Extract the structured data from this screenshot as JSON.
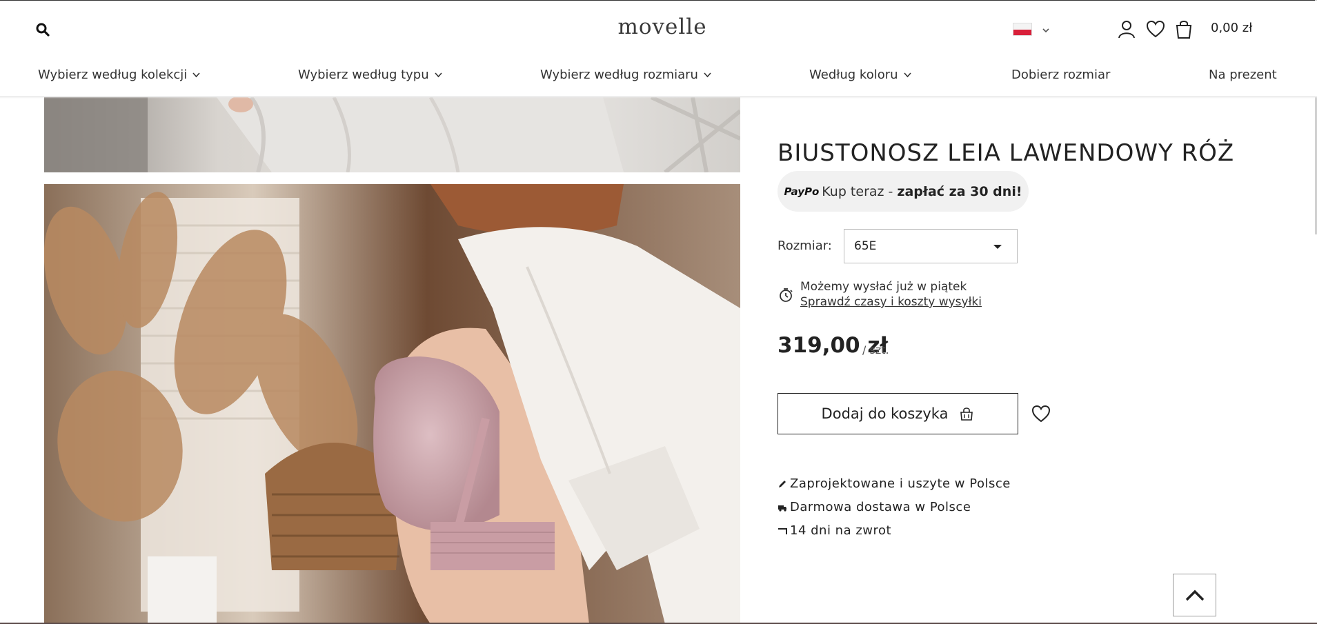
{
  "header": {
    "logo": "movelle",
    "cart_total": "0,00 zł",
    "icons": [
      "search-icon",
      "flag-pl-icon",
      "chevron-down-icon",
      "user-icon",
      "heart-icon",
      "bag-icon"
    ]
  },
  "nav": {
    "items": [
      {
        "label": "Wybierz według kolekcji",
        "dropdown": true
      },
      {
        "label": "Wybierz według typu",
        "dropdown": true
      },
      {
        "label": "Wybierz według rozmiaru",
        "dropdown": true
      },
      {
        "label": "Według koloru",
        "dropdown": true
      },
      {
        "label": "Dobierz rozmiar",
        "dropdown": false
      },
      {
        "label": "Na prezent",
        "dropdown": false
      }
    ]
  },
  "product": {
    "title": "BIUSTONOSZ LEIA LAWENDOWY RÓŻ",
    "paypo": {
      "logo": "PayPo",
      "text": "Kup teraz -",
      "strong": "zapłać za 30 dni!"
    },
    "size": {
      "label": "Rozmiar:",
      "selected": "65E"
    },
    "shipping": {
      "text": "Możemy wysłać już w piątek",
      "link": "Sprawdź czasy i koszty wysyłki"
    },
    "price": "319,00 zł",
    "unit": "/ szt.",
    "add_to_cart": "Dodaj do koszyka",
    "features": [
      {
        "icon": "pencil-icon",
        "text": "Zaprojektowane i uszyte w Polsce"
      },
      {
        "icon": "truck-icon",
        "text": "Darmowa dostawa w Polsce"
      },
      {
        "icon": "return-arrow-icon",
        "text": "14 dni na zwrot"
      }
    ]
  },
  "colors": {
    "bra_pink": "#c99da4",
    "pampas": "#b98a61",
    "shirt": "#f3f0ec",
    "flag_red": "#d8203a"
  }
}
